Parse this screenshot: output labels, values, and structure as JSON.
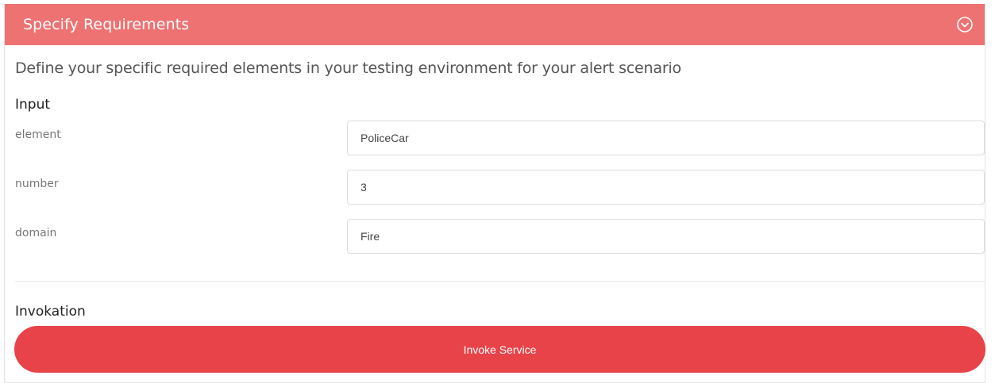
{
  "header": {
    "title": "Specify Requirements",
    "toggle_icon": "chevron-down-circle-icon",
    "color": "#ee7272"
  },
  "description": "Define your specific required elements in your testing environment for your alert scenario",
  "input_section": {
    "title": "Input",
    "fields": [
      {
        "label": "element",
        "value": "PoliceCar"
      },
      {
        "label": "number",
        "value": "3"
      },
      {
        "label": "domain",
        "value": "Fire"
      }
    ]
  },
  "invocation": {
    "title": "Invokation",
    "button_label": "Invoke Service",
    "button_color": "#e84349"
  }
}
